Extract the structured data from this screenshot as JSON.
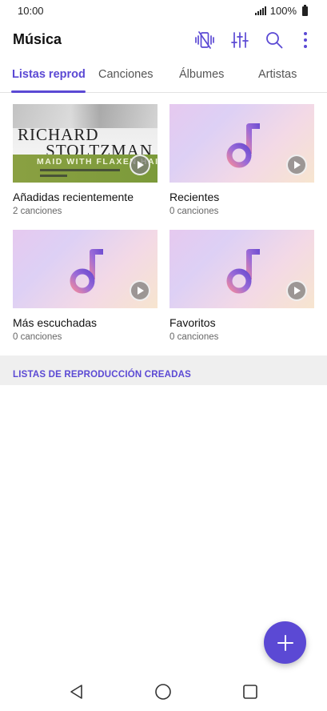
{
  "status_bar": {
    "time": "10:00",
    "battery_text": "100%",
    "icons": [
      "signal-icon",
      "battery-icon"
    ]
  },
  "app_bar": {
    "title": "Música",
    "actions": [
      "vibration-mode-icon",
      "equalizer-icon",
      "search-icon",
      "more-options-icon"
    ],
    "accent_color": "#5b49d4"
  },
  "tabs": [
    {
      "label": "Listas reproducción",
      "visible_label": "Listas reprodu",
      "active": true
    },
    {
      "label": "Canciones",
      "active": false
    },
    {
      "label": "Álbumes",
      "active": false
    },
    {
      "label": "Artistas",
      "active": false
    }
  ],
  "playlists": [
    {
      "title": "Añadidas recientemente",
      "count": "2 canciones",
      "thumb": "album-art",
      "album_art_text": {
        "line1": "RICHARD",
        "line2": "STOLTZMAN",
        "line3": "MAID WITH FLAXEN HAIR"
      }
    },
    {
      "title": "Recientes",
      "count": "0 canciones",
      "thumb": "music-note-icon"
    },
    {
      "title": "Más escuchadas",
      "count": "0 canciones",
      "thumb": "music-note-icon"
    },
    {
      "title": "Favoritos",
      "count": "0 canciones",
      "thumb": "music-note-icon"
    }
  ],
  "section": {
    "label": "LISTAS DE REPRODUCCIÓN CREADAS"
  },
  "fab": {
    "icon": "add-icon",
    "color": "#5b49d4"
  },
  "nav_bar": {
    "buttons": [
      "back-icon",
      "home-icon",
      "recent-apps-icon"
    ]
  }
}
